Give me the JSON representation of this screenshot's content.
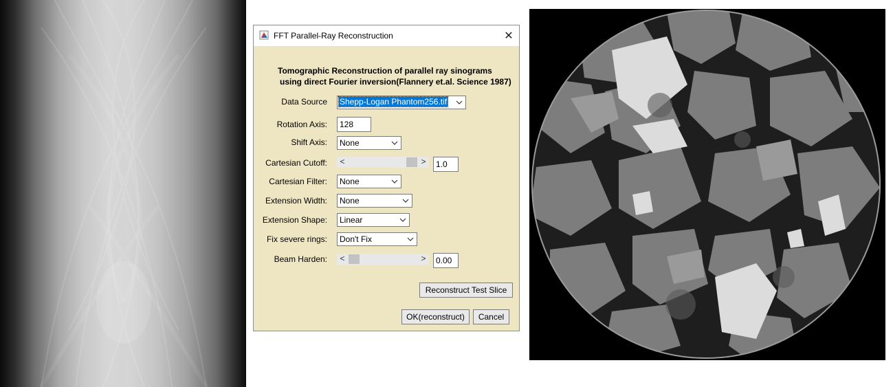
{
  "dialog": {
    "title": "FFT Parallel-Ray Reconstruction",
    "close_glyph": "✕",
    "heading_line1": "Tomographic Reconstruction of parallel ray sinograms",
    "heading_line2": "using direct Fourier inversion(Flannery et.al. Science 1987)",
    "fields": {
      "data_source": {
        "label": "Data Source",
        "value": "Shepp-Logan Phantom256.tif"
      },
      "rotation_axis": {
        "label": "Rotation Axis:",
        "value": "128"
      },
      "shift_axis": {
        "label": "Shift Axis:",
        "value": "None"
      },
      "cartesian_cutoff": {
        "label": "Cartesian Cutoff:",
        "value": "1.0",
        "slider_level": 1.0
      },
      "cartesian_filter": {
        "label": "Cartesian Filter:",
        "value": "None"
      },
      "extension_width": {
        "label": "Extension Width:",
        "value": "None"
      },
      "extension_shape": {
        "label": "Extension Shape:",
        "value": "Linear"
      },
      "fix_severe_rings": {
        "label": "Fix severe rings:",
        "value": "Don't Fix"
      },
      "beam_harden": {
        "label": "Beam Harden:",
        "value": "0.00",
        "slider_level": 0.0
      }
    },
    "buttons": {
      "test_slice": "Reconstruct Test Slice",
      "ok": "OK(reconstruct)",
      "cancel": "Cancel"
    },
    "scroll_left_glyph": "<",
    "scroll_right_glyph": ">"
  },
  "images": {
    "sinogram": "sinogram-image",
    "reconstruction": "reconstructed-slice-image"
  },
  "colors": {
    "dialog_bg": "#eee5c3",
    "selection": "#0078d7"
  }
}
